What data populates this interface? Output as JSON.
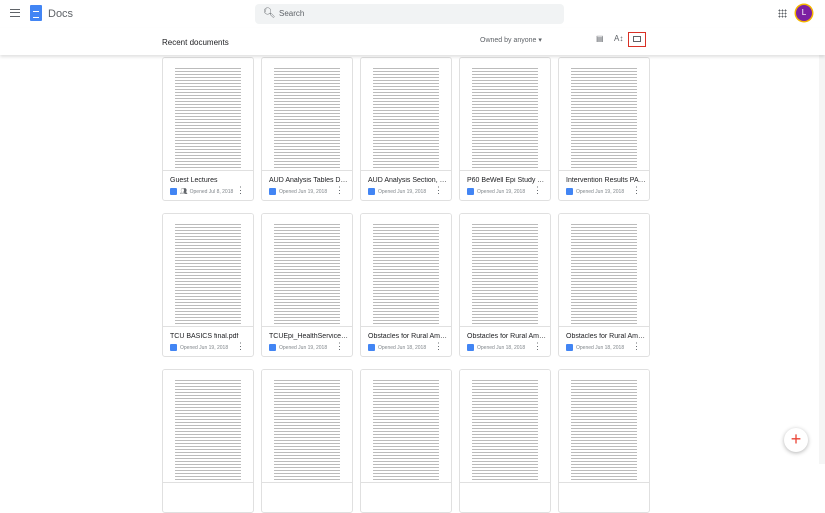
{
  "header": {
    "app_name": "Docs",
    "search_placeholder": "Search",
    "avatar_initial": "L"
  },
  "toolbar": {
    "title": "Recent documents",
    "owner_filter": "Owned by anyone"
  },
  "documents": [
    {
      "name": "Guest Lectures",
      "opened": "Opened Jul 8, 2018",
      "shared": true
    },
    {
      "name": "AUD Analysis Tables Draf...",
      "opened": "Opened Jun 19, 2018"
    },
    {
      "name": "AUD Analysis Section, SR...",
      "opened": "Opened Jun 19, 2018"
    },
    {
      "name": "P60 BeWell Epi Study TC...",
      "opened": "Opened Jun 19, 2018"
    },
    {
      "name": "Intervention Results PAR...",
      "opened": "Opened Jun 19, 2018"
    },
    {
      "name": "TCU BASICS final.pdf",
      "opened": "Opened Jun 19, 2018"
    },
    {
      "name": "TCUEpi_HealthServiceUti...",
      "opened": "Opened Jun 19, 2018"
    },
    {
      "name": "Obstacles for Rural Amer...",
      "opened": "Opened Jun 18, 2018"
    },
    {
      "name": "Obstacles for Rural Amer...",
      "opened": "Opened Jun 18, 2018"
    },
    {
      "name": "Obstacles for Rural Amer...",
      "opened": "Opened Jun 18, 2018"
    }
  ]
}
